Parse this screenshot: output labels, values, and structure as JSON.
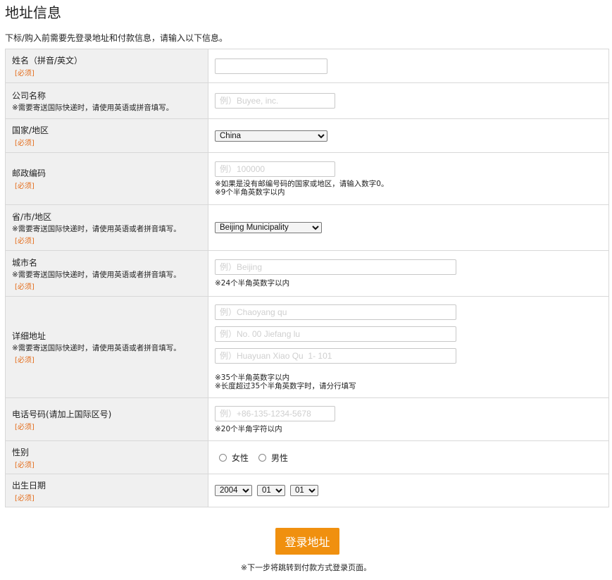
{
  "page": {
    "title": "地址信息",
    "intro": "下标/购入前需要先登录地址和付款信息，请输入以下信息。",
    "required_tag": "[必须]",
    "submit_label": "登录地址",
    "footer_note": "※下一步将跳转到付款方式登录页面。"
  },
  "fields": {
    "name": {
      "label": "姓名（拼音/英文）",
      "value": "",
      "placeholder": ""
    },
    "company": {
      "label": "公司名称",
      "note": "※需要寄送国际快递时，请使用英语或拼音填写。",
      "placeholder": "例）Buyee, inc."
    },
    "country": {
      "label": "国家/地区",
      "selected": "China"
    },
    "postal": {
      "label": "邮政编码",
      "placeholder": "例）100000",
      "hint1": "※如果是没有邮编号码的国家或地区，请输入数字0。",
      "hint2": "※9个半角英数字以内"
    },
    "province": {
      "label": "省/市/地区",
      "note": "※需要寄送国际快递时，请使用英语或者拼音填写。",
      "selected": "Beijing Municipality"
    },
    "city": {
      "label": "城市名",
      "note": "※需要寄送国际快递时，请使用英语或者拼音填写。",
      "placeholder": "例）Beijing",
      "hint": "※24个半角英数字以内"
    },
    "address": {
      "label": "详细地址",
      "note": "※需要寄送国际快递时，请使用英语或者拼音填写。",
      "placeholder1": "例）Chaoyang qu",
      "placeholder2": "例）No. 00 Jiefang lu",
      "placeholder3": "例）Huayuan Xiao Qu  1- 101",
      "hint1": "※35个半角英数字以内",
      "hint2": "※长度超过35个半角英数字时，请分行填写"
    },
    "phone": {
      "label": "电话号码(请加上国际区号)",
      "placeholder": "例）+86-135-1234-5678",
      "hint": "※20个半角字符以内"
    },
    "gender": {
      "label": "性别",
      "female": "女性",
      "male": "男性"
    },
    "birthday": {
      "label": "出生日期",
      "year": "2004",
      "month": "01",
      "day": "01"
    }
  }
}
